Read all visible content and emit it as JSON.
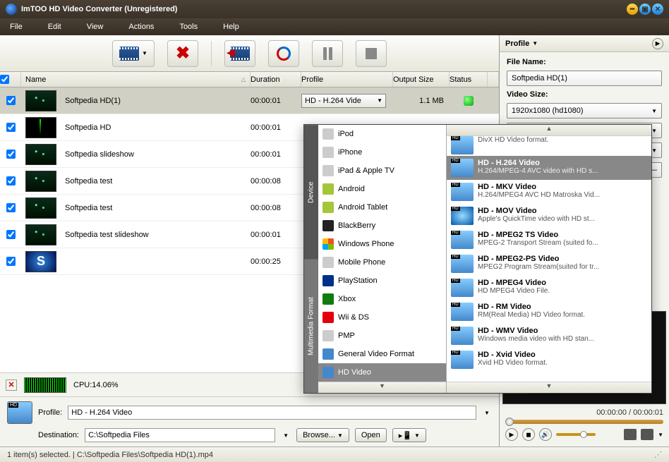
{
  "app": {
    "title": "ImTOO HD Video Converter (Unregistered)"
  },
  "menu": [
    "File",
    "Edit",
    "View",
    "Actions",
    "Tools",
    "Help"
  ],
  "columns": {
    "name": "Name",
    "duration": "Duration",
    "profile": "Profile",
    "output": "Output Size",
    "status": "Status"
  },
  "rows": [
    {
      "name": "Softpedia HD(1)",
      "duration": "00:00:01",
      "profile": "HD - H.264 Vide",
      "output": "1.1 MB",
      "selected": true,
      "thumb": "forest"
    },
    {
      "name": "Softpedia HD",
      "duration": "00:00:01",
      "thumb": "dark"
    },
    {
      "name": "Softpedia slideshow",
      "duration": "00:00:01",
      "thumb": "forest"
    },
    {
      "name": "Softpedia test",
      "duration": "00:00:08",
      "thumb": "forest"
    },
    {
      "name": "Softpedia test",
      "duration": "00:00:08",
      "thumb": "forest"
    },
    {
      "name": "Softpedia test slideshow",
      "duration": "00:00:01",
      "thumb": "forest"
    },
    {
      "name": "",
      "duration": "00:00:25",
      "thumb": "s"
    }
  ],
  "cpu": {
    "label": "CPU:14.06%"
  },
  "bottom": {
    "profile_label": "Profile:",
    "profile_value": "HD - H.264 Video",
    "dest_label": "Destination:",
    "dest_value": "C:\\Softpedia Files",
    "browse": "Browse...",
    "open": "Open"
  },
  "status": "1 item(s) selected. | C:\\Softpedia Files\\Softpedia HD(1).mp4",
  "right": {
    "head": "Profile",
    "filename_label": "File Name:",
    "filename_value": "Softpedia HD(1)",
    "videosize_label": "Video Size:",
    "videosize_value": "1920x1080 (hd1080)",
    "time": "00:00:00 / 00:00:01"
  },
  "popup": {
    "tabs": [
      "Device",
      "Multimedia Format"
    ],
    "devices": [
      "iPod",
      "iPhone",
      "iPad & Apple TV",
      "Android",
      "Android Tablet",
      "BlackBerry",
      "Windows Phone",
      "Mobile Phone",
      "PlayStation",
      "Xbox",
      "Wii & DS",
      "PMP",
      "General Video Format",
      "HD Video"
    ],
    "device_selected": "HD Video",
    "formats_top": "DivX HD Video format.",
    "formats": [
      {
        "t": "HD - H.264 Video",
        "d": "H.264/MPEG-4 AVC video with HD s...",
        "sel": true
      },
      {
        "t": "HD - MKV Video",
        "d": "H.264/MPEG4 AVC HD Matroska Vid..."
      },
      {
        "t": "HD - MOV Video",
        "d": "Apple's QuickTime video with HD st..."
      },
      {
        "t": "HD - MPEG2 TS Video",
        "d": "MPEG-2 Transport Stream (suited fo..."
      },
      {
        "t": "HD - MPEG2-PS Video",
        "d": "MPEG2 Program Stream(suited for tr..."
      },
      {
        "t": "HD - MPEG4 Video",
        "d": "HD MPEG4 Video File."
      },
      {
        "t": "HD - RM Video",
        "d": "RM(Real Media) HD Video format."
      },
      {
        "t": "HD - WMV Video",
        "d": "Windows media video with HD stan..."
      },
      {
        "t": "HD - Xvid Video",
        "d": "Xvid HD Video format."
      }
    ]
  }
}
